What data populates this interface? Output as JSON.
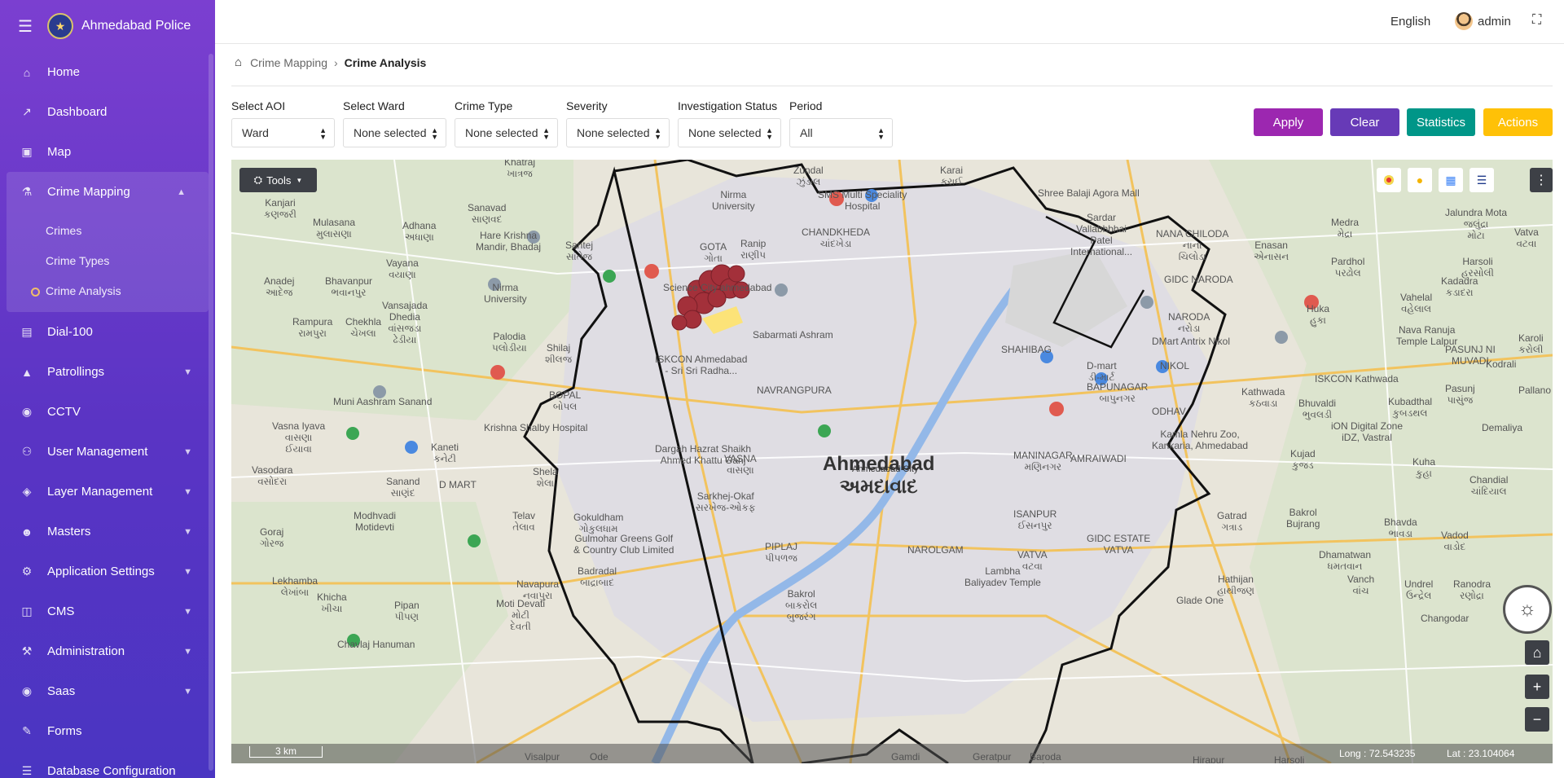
{
  "app": {
    "brand": "Ahmedabad Police"
  },
  "sidebar": {
    "items": [
      {
        "label": "Home",
        "icon": "home-icon"
      },
      {
        "label": "Dashboard",
        "icon": "chart-line-icon"
      },
      {
        "label": "Map",
        "icon": "map-icon"
      },
      {
        "label": "Crime Mapping",
        "icon": "crime-mapping-icon",
        "expanded": true
      },
      {
        "label": "Dial-100",
        "icon": "document-icon"
      },
      {
        "label": "Patrollings",
        "icon": "road-icon"
      },
      {
        "label": "CCTV",
        "icon": "camera-icon"
      },
      {
        "label": "User Management",
        "icon": "users-icon"
      },
      {
        "label": "Layer Management",
        "icon": "layers-icon"
      },
      {
        "label": "Masters",
        "icon": "people-icon"
      },
      {
        "label": "Application Settings",
        "icon": "cogs-icon"
      },
      {
        "label": "CMS",
        "icon": "cms-icon"
      },
      {
        "label": "Administration",
        "icon": "wrench-icon"
      },
      {
        "label": "Saas",
        "icon": "globe-icon"
      },
      {
        "label": "Forms",
        "icon": "form-icon"
      },
      {
        "label": "Database Configuration",
        "icon": "database-icon"
      }
    ],
    "subitems": [
      {
        "label": "Crimes"
      },
      {
        "label": "Crime Types"
      },
      {
        "label": "Crime Analysis",
        "active": true
      }
    ]
  },
  "topbar": {
    "language": "English",
    "user": "admin"
  },
  "breadcrumb": {
    "parent": "Crime Mapping",
    "current": "Crime Analysis"
  },
  "filters": [
    {
      "label": "Select AOI",
      "value": "Ward"
    },
    {
      "label": "Select Ward",
      "value": "None selected"
    },
    {
      "label": "Crime Type",
      "value": "None selected"
    },
    {
      "label": "Severity",
      "value": "None selected"
    },
    {
      "label": "Investigation Status",
      "value": "None selected"
    },
    {
      "label": "Period",
      "value": "All"
    }
  ],
  "buttons": {
    "apply": "Apply",
    "clear": "Clear",
    "statistics": "Statistics",
    "actions": "Actions"
  },
  "colors": {
    "apply": "#9c27b0",
    "clear": "#673ab7",
    "statistics": "#009688",
    "actions": "#ffc107",
    "boundary": "#111111",
    "hotspot": "#a3303a"
  },
  "map": {
    "tools_label": "Tools",
    "scale_label": "3 km",
    "longitude": "Long : 72.543235",
    "latitude": "Lat : 23.104064",
    "city": "Ahmedabad",
    "city_gu": "અમદાવાદ",
    "city_sub": "Ahmedabad City",
    "places": [
      {
        "name": "Khatraj\nખાત્રજ"
      },
      {
        "name": "Zundal\nઝુંડાલ"
      },
      {
        "name": "Karai\nકરાઈ"
      },
      {
        "name": "Kanjari\nકણજરી"
      },
      {
        "name": "Nirma\nUniversity"
      },
      {
        "name": "SMS Multi Speciality\nHospital"
      },
      {
        "name": "Shree Balaji Agora Mall"
      },
      {
        "name": "Mulasana\nમુલાસણા"
      },
      {
        "name": "Sanavad\nસાણવદ"
      },
      {
        "name": "Adhana\nઅધાણા"
      },
      {
        "name": "Hare Krishna\nMandir, Bhadaj"
      },
      {
        "name": "Santej\nસાંતેજ"
      },
      {
        "name": "GOTA\nગોતા"
      },
      {
        "name": "Ranip\nરાણીપ"
      },
      {
        "name": "CHANDKHEDA\nચાંદખેડા"
      },
      {
        "name": "Sardar\nVallabhbhai\nPatel\nInternational..."
      },
      {
        "name": "NANA CHILODA\nનાના\nચિલોડા"
      },
      {
        "name": "Enasan\nએનાસન"
      },
      {
        "name": "Medra\nમેદ્રા"
      },
      {
        "name": "Jalundra Mota\nજલુંદ્રા\nમોટા"
      },
      {
        "name": "Vatva\nવટવા"
      },
      {
        "name": "Vayana\nવયાણા"
      },
      {
        "name": "Nirma\nUniversity"
      },
      {
        "name": "Science City ahmedabad"
      },
      {
        "name": "Pardhol\nપરઢોલ"
      },
      {
        "name": "Harsoli\nહરસોલી"
      },
      {
        "name": "Anadej\nઆદેજ"
      },
      {
        "name": "Bhavanpur\nભવાનપુર"
      },
      {
        "name": "Vansajada\nDhedia\nવાંસજડા\nઢેડીયા"
      },
      {
        "name": "Rampura\nરામપુરા"
      },
      {
        "name": "Chekhla\nચેખલા"
      },
      {
        "name": "Palodia\nપલોડીયા"
      },
      {
        "name": "Shilaj\nશીલજ"
      },
      {
        "name": "GIDC NARODA"
      },
      {
        "name": "NARODA\nનરોડા"
      },
      {
        "name": "Huka\nહુકા"
      },
      {
        "name": "Vahelal\nવહેલાલ"
      },
      {
        "name": "Kadadra\nકડાદરા"
      },
      {
        "name": "Nava Ranuja\nTemple Lalpur"
      },
      {
        "name": "PASUNJ NI\nMUVADI"
      },
      {
        "name": "Karoli\nકરોલી"
      },
      {
        "name": "ISKCON Ahmedabad\n- Sri Sri Radha..."
      },
      {
        "name": "Sabarmati Ashram"
      },
      {
        "name": "SHAHIBAG"
      },
      {
        "name": "DMart Antrix Nikol"
      },
      {
        "name": "D-mart\nડી-માર્ટ"
      },
      {
        "name": "NIKOL"
      },
      {
        "name": "Kodrali"
      },
      {
        "name": "Pasunj\nપાસુંજ"
      },
      {
        "name": "Pallano Mat"
      },
      {
        "name": "ISKCON Kathwada"
      },
      {
        "name": "Kathwada\nકઠવાડા"
      },
      {
        "name": "Bhuvaldi\nભુવલડી"
      },
      {
        "name": "Kubadthal\nકુબડથલ"
      },
      {
        "name": "Muni Aashram Sanand"
      },
      {
        "name": "BOPAL\nબોપલ"
      },
      {
        "name": "NAVRANGPURA"
      },
      {
        "name": "BAPUNAGAR\nબાપુનગર"
      },
      {
        "name": "ODHAV"
      },
      {
        "name": "Vasna Iyava\nવાસણા\nઈયાવા"
      },
      {
        "name": "Krishna Shalby Hospital"
      },
      {
        "name": "Kamla Nehru Zoo,\nKankaria, Ahmedabad"
      },
      {
        "name": "iON Digital Zone\niDZ, Vastral"
      },
      {
        "name": "Demaliya"
      },
      {
        "name": "Kaneti\nકનેટી"
      },
      {
        "name": "Dargah Hazrat Shaikh\nAhmed Khattu Ganj"
      },
      {
        "name": "VASNA\nવાસણા"
      },
      {
        "name": "MANINAGAR\nમણિનગર"
      },
      {
        "name": "AMRAIWADI"
      },
      {
        "name": "Kujad\nકુજડ"
      },
      {
        "name": "Kuha\nકુહા"
      },
      {
        "name": "Vasodara\nવસોદરા"
      },
      {
        "name": "Sanand\nસાણંદ"
      },
      {
        "name": "D MART"
      },
      {
        "name": "Shela\nશેલા"
      },
      {
        "name": "Sarkhej-Okaf\nસરખેજ-ઓકફ"
      },
      {
        "name": "Chandial\nચાંદિયાલ"
      },
      {
        "name": "Telav\nતેલાવ"
      },
      {
        "name": "Gokuldham\nગોકુલધામ"
      },
      {
        "name": "ISANPUR\nઈસનપુર"
      },
      {
        "name": "Gatrad\nગત્રાડ"
      },
      {
        "name": "Bakrol\nBujrang"
      },
      {
        "name": "Bhavda\nભાવડા"
      },
      {
        "name": "Modhvadi\nMotidevti"
      },
      {
        "name": "Goraj\nગોરજ"
      },
      {
        "name": "Gulmohar Greens Golf\n& Country Club Limited"
      },
      {
        "name": "GIDC ESTATE\nVATVA"
      },
      {
        "name": "Vadod\nવાડોદ"
      },
      {
        "name": "PIPLAJ\nપીપળજ"
      },
      {
        "name": "NAROLGAM"
      },
      {
        "name": "VATVA\nવટવા"
      },
      {
        "name": "Dhamatwan\nધમતવાન"
      },
      {
        "name": "Lekhamba\nલેખાંબા"
      },
      {
        "name": "Badradal\nબાદ્રાબાદ"
      },
      {
        "name": "Navapura\nનવાપુરા"
      },
      {
        "name": "Lambha\nBaliyadev Temple"
      },
      {
        "name": "Vanch\nવાંચ"
      },
      {
        "name": "Undrel\nઉન્દ્રેલ"
      },
      {
        "name": "Ranodra\nરણોદ્રા"
      },
      {
        "name": "Khicha\nખીચા"
      },
      {
        "name": "Pipan\nપીપણ"
      },
      {
        "name": "Moti Devati\nમોટી\nદેવતી"
      },
      {
        "name": "Bakrol\nબાકરોલ\nબુજરંગ"
      },
      {
        "name": "Hathijan\nહાથીજણ"
      },
      {
        "name": "Glade One"
      },
      {
        "name": "Chavlaj Hanuman"
      },
      {
        "name": "Changodar"
      },
      {
        "name": "Visalpur"
      },
      {
        "name": "Ode"
      },
      {
        "name": "Gamdi"
      },
      {
        "name": "Geratpur"
      },
      {
        "name": "Baroda\nબડોદરા"
      },
      {
        "name": "Hirapur"
      },
      {
        "name": "Harsoli"
      }
    ]
  }
}
